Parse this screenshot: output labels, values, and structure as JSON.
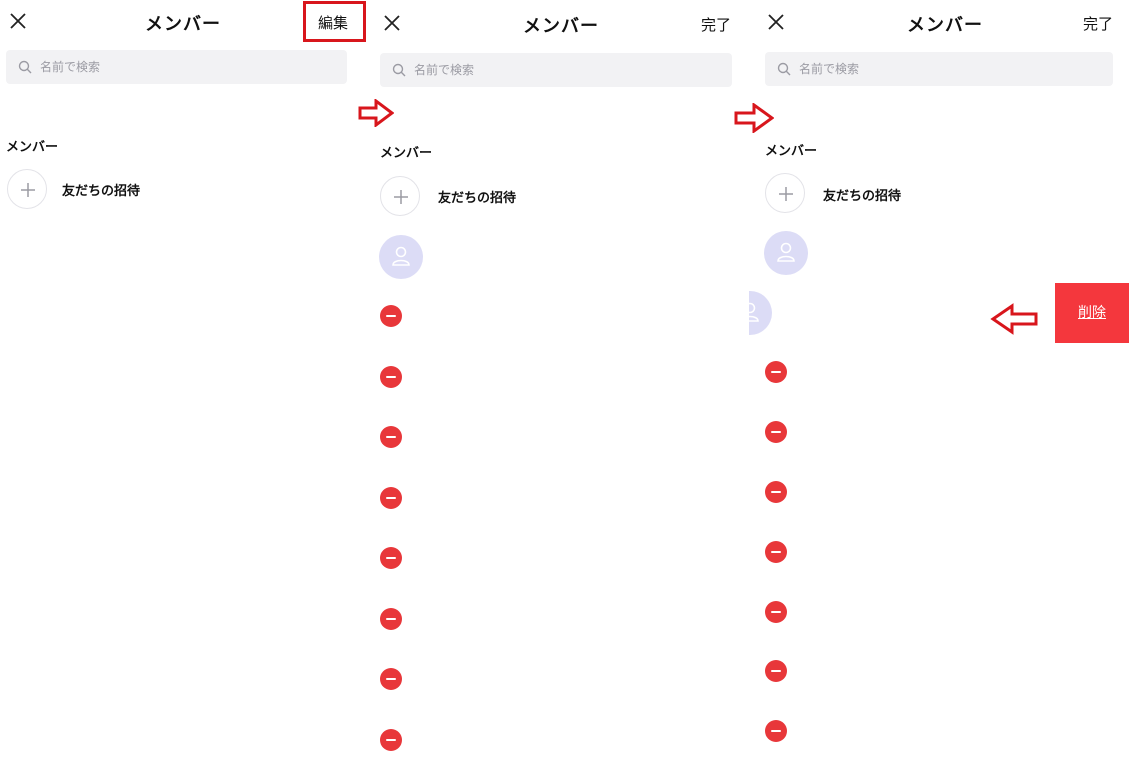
{
  "panels": [
    {
      "header": {
        "title": "メンバー",
        "action_label": "編集"
      },
      "search": {
        "placeholder": "名前で検索"
      },
      "section_label": "メンバー",
      "invite_label": "友だちの招待"
    },
    {
      "header": {
        "title": "メンバー",
        "action_label": "完了"
      },
      "search": {
        "placeholder": "名前で検索"
      },
      "section_label": "メンバー",
      "invite_label": "友だちの招待"
    },
    {
      "header": {
        "title": "メンバー",
        "action_label": "完了"
      },
      "search": {
        "placeholder": "名前で検索"
      },
      "section_label": "メンバー",
      "invite_label": "友だちの招待",
      "delete_label": "削除"
    }
  ],
  "colors": {
    "highlight_box": "#d8161c",
    "arrow": "#d8161c",
    "remove_icon": "#e8373a",
    "delete_button": "#f4373d",
    "avatar": "#dcdcf6"
  },
  "icons": [
    "close-icon",
    "search-icon",
    "plus-icon",
    "person-icon",
    "remove-icon",
    "arrow-right-icon",
    "arrow-left-icon"
  ]
}
